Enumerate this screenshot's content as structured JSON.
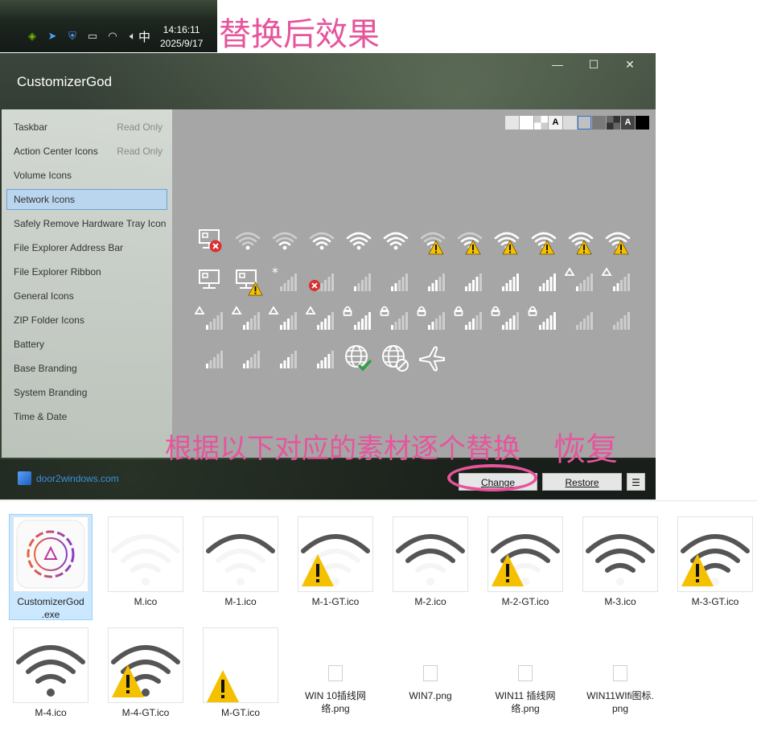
{
  "taskbar": {
    "tray_icons": [
      "nvidia-icon",
      "bird-icon",
      "shield-icon",
      "battery-icon",
      "wifi-icon",
      "volume-icon"
    ],
    "ime_indicator": "中",
    "time": "14:16:11",
    "date": "2025/9/17"
  },
  "annotations": {
    "result_title": "替换后效果",
    "instruction": "根据以下对应的素材逐个替换",
    "restore_note": "恢复",
    "highlight_color": "#e6559c"
  },
  "app": {
    "title": "CustomizerGod",
    "window_controls": [
      "minimize-icon",
      "maximize-icon",
      "close-icon"
    ],
    "sidebar": {
      "items": [
        {
          "label": "Taskbar",
          "badge": "Read Only"
        },
        {
          "label": "Action Center Icons",
          "badge": "Read Only"
        },
        {
          "label": "Volume Icons",
          "badge": ""
        },
        {
          "label": "Network Icons",
          "badge": ""
        },
        {
          "label": "Safely Remove Hardware Tray Icon",
          "badge": ""
        },
        {
          "label": "File Explorer Address Bar",
          "badge": ""
        },
        {
          "label": "File Explorer Ribbon",
          "badge": ""
        },
        {
          "label": "General Icons",
          "badge": ""
        },
        {
          "label": "ZIP Folder Icons",
          "badge": ""
        },
        {
          "label": "Battery",
          "badge": ""
        },
        {
          "label": "Base Branding",
          "badge": ""
        },
        {
          "label": "System Branding",
          "badge": ""
        },
        {
          "label": "Time & Date",
          "badge": ""
        }
      ],
      "selected": "Network Icons"
    },
    "swatches": [
      "#e6e6e6",
      "#ffffff",
      "checker-light",
      "A-light",
      "#dcdcdc",
      "#c0c0c0-selected",
      "#7a7a7a",
      "checker-dark",
      "A-dark",
      "#000000"
    ],
    "swatch_letter": "A",
    "icon_rows": [
      [
        "ethernet-error-icon",
        "wifi-0-icon",
        "wifi-1-icon",
        "wifi-2-icon",
        "wifi-3-icon",
        "wifi-4-icon",
        "wifi-1-warning-icon",
        "wifi-2-warning-icon",
        "wifi-3-warning-icon",
        "wifi-4-warning-icon",
        "wifi-3-warning-icon",
        "wifi-4-warning-icon"
      ],
      [
        "ethernet-icon",
        "ethernet-warning-icon",
        "cellular-asterisk-icon",
        "cellular-error-icon",
        "cellular-bars-icon",
        "cellular-bars-icon",
        "cellular-bars-icon",
        "cellular-bars-icon",
        "cellular-bars-icon",
        "cellular-bars-icon",
        "cellular-roaming-icon",
        "cellular-roaming-icon"
      ],
      [
        "cellular-roaming-icon",
        "cellular-roaming-icon",
        "cellular-roaming-icon",
        "cellular-roaming-icon",
        "cellular-lock-icon",
        "cellular-lock-icon",
        "cellular-lock-icon",
        "cellular-lock-icon",
        "cellular-lock-icon",
        "cellular-lock-icon",
        "cellular-bars-icon",
        "cellular-bars-icon"
      ],
      [
        "cellular-bars-icon",
        "cellular-bars-icon",
        "cellular-bars-icon",
        "cellular-bars-icon",
        "globe-check-icon",
        "globe-blocked-icon",
        "airplane-icon"
      ]
    ],
    "footer": {
      "link_text": "door2windows.com",
      "change_label": "Change",
      "restore_label": "Restore",
      "menu_label": "☰"
    }
  },
  "files": [
    {
      "name": "CustomizerGod\n.exe",
      "kind": "app-gear",
      "selected": true
    },
    {
      "name": "M.ico",
      "kind": "wifi-faint"
    },
    {
      "name": "M-1.ico",
      "kind": "wifi-1"
    },
    {
      "name": "M-1-GT.ico",
      "kind": "wifi-1-warn"
    },
    {
      "name": "M-2.ico",
      "kind": "wifi-2"
    },
    {
      "name": "M-2-GT.ico",
      "kind": "wifi-2-warn"
    },
    {
      "name": "M-3.ico",
      "kind": "wifi-3"
    },
    {
      "name": "M-3-GT.ico",
      "kind": "wifi-3-warn"
    },
    {
      "name": "M-4.ico",
      "kind": "wifi-4"
    },
    {
      "name": "M-4-GT.ico",
      "kind": "wifi-4-warn"
    },
    {
      "name": "M-GT.ico",
      "kind": "warn-only"
    },
    {
      "name": "WIN 10插线网\n络.png",
      "kind": "small"
    },
    {
      "name": "WIN7.png",
      "kind": "small"
    },
    {
      "name": "WIN11 插线网\n络.png",
      "kind": "small"
    },
    {
      "name": "WIN11WIfi图标.\npng",
      "kind": "small"
    }
  ]
}
